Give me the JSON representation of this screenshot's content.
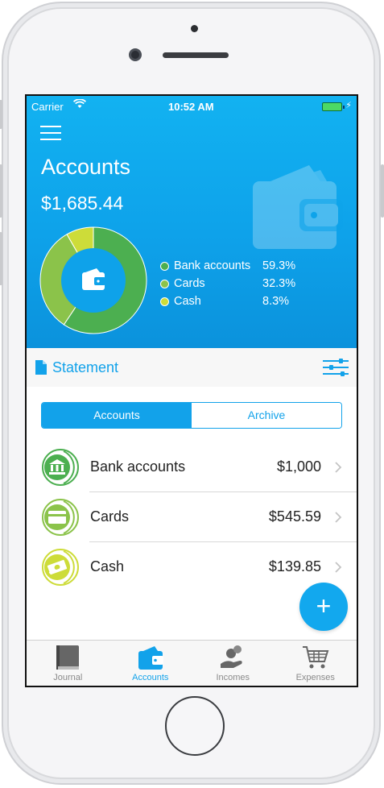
{
  "status_bar": {
    "carrier": "Carrier",
    "time": "10:52 AM"
  },
  "header": {
    "title": "Accounts",
    "total": "$1,685.44"
  },
  "distribution": {
    "items": [
      {
        "label": "Bank accounts",
        "percent": "59.3%",
        "value": 59.3,
        "color": "#4caf50"
      },
      {
        "label": "Cards",
        "percent": "32.3%",
        "value": 32.3,
        "color": "#8bc34a"
      },
      {
        "label": "Cash",
        "percent": "8.3%",
        "value": 8.3,
        "color": "#cddc39"
      }
    ]
  },
  "statement": {
    "label": "Statement"
  },
  "segmented": {
    "active": "Accounts",
    "inactive": "Archive"
  },
  "accounts": [
    {
      "name": "Bank accounts",
      "amount": "$1,000",
      "icon": "bank-icon",
      "color": "#4caf50"
    },
    {
      "name": "Cards",
      "amount": "$545.59",
      "icon": "credit-card-icon",
      "color": "#8bc34a"
    },
    {
      "name": "Cash",
      "amount": "$139.85",
      "icon": "cash-icon",
      "color": "#cddc39"
    }
  ],
  "fab": {
    "label": "+"
  },
  "tabs": [
    {
      "label": "Journal",
      "icon": "journal-icon"
    },
    {
      "label": "Accounts",
      "icon": "wallet-icon",
      "active": true
    },
    {
      "label": "Incomes",
      "icon": "incomes-icon"
    },
    {
      "label": "Expenses",
      "icon": "cart-icon"
    }
  ]
}
